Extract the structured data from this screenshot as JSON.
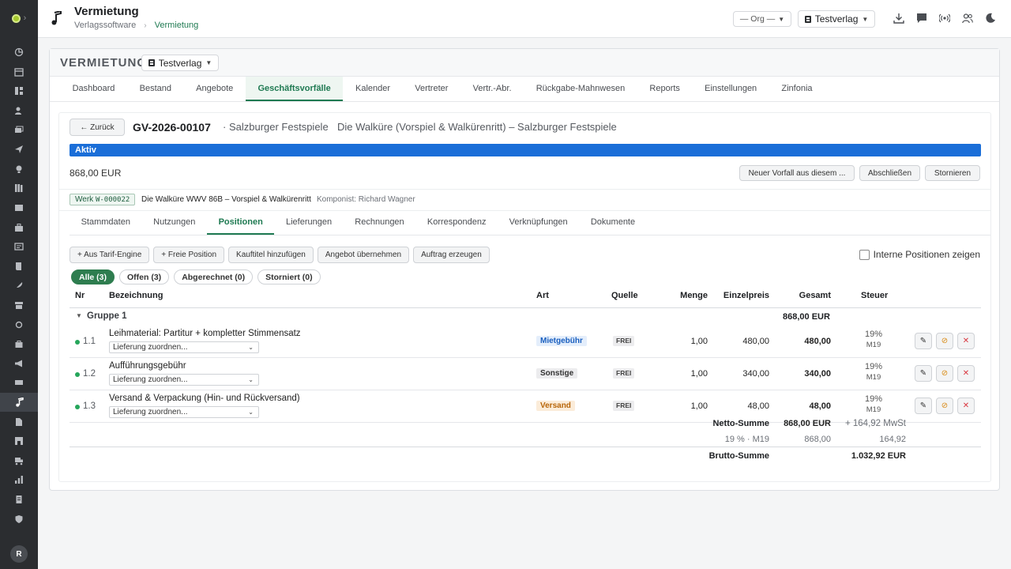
{
  "topbar": {
    "title": "Vermietung",
    "breadcrumb": [
      "Verlagssoftware",
      "Vermietung"
    ],
    "org_select": "— Org —",
    "verlag_select": "Testverlag",
    "actions": [
      "download-icon",
      "chat-icon",
      "broadcast-icon",
      "users-icon",
      "moon-icon"
    ]
  },
  "sidebar": {
    "avatar": "R",
    "icons": [
      "chart-icon",
      "calendar-icon",
      "grid-icon",
      "person-edit-icon",
      "layers-icon",
      "send-icon",
      "bulb-icon",
      "books-icon",
      "image-icon",
      "briefcase-icon",
      "news-icon",
      "scroll-icon",
      "feather-icon",
      "archive-icon",
      "circle-icon",
      "bag-icon",
      "megaphone-icon",
      "film-icon",
      "music-icon",
      "document-icon",
      "store-icon",
      "truck-icon",
      "bar-chart-icon",
      "receipt-icon",
      "shield-icon"
    ],
    "active_index": 18
  },
  "card": {
    "title": "VERMIETUNG",
    "verlag_select": "Testverlag",
    "tabs": [
      "Dashboard",
      "Bestand",
      "Angebote",
      "Geschäftsvorfälle",
      "Kalender",
      "Vertreter",
      "Vertr.-Abr.",
      "Rückgabe-Mahnwesen",
      "Reports",
      "Einstellungen",
      "Zinfonia"
    ],
    "active_tab": 3
  },
  "vorfall": {
    "back_label": "← Zurück",
    "id": "GV-2026-00107",
    "partner": "· Salzburger Festspiele",
    "description": "Die Walküre (Vorspiel & Walkürenritt) – Salzburger Festspiele",
    "status": "Aktiv",
    "amount": "868,00 EUR",
    "actions": [
      "Neuer Vorfall aus diesem ...",
      "Abschließen",
      "Stornieren"
    ],
    "werk_label": "Werk",
    "werk_id": "W-000022",
    "werk_title": "Die Walküre WWV 86B – Vorspiel & Walkürenritt",
    "werk_composer": "Komponist: Richard Wagner"
  },
  "subtabs": {
    "items": [
      "Stammdaten",
      "Nutzungen",
      "Positionen",
      "Lieferungen",
      "Rechnungen",
      "Korrespondenz",
      "Verknüpfungen",
      "Dokumente"
    ],
    "active": 2
  },
  "toolbar": {
    "buttons": [
      "+ Aus Tarif-Engine",
      "+ Freie Position",
      "Kauftitel hinzufügen",
      "Angebot übernehmen",
      "Auftrag erzeugen"
    ],
    "interne_label": "Interne Positionen zeigen"
  },
  "filters": [
    "Alle (3)",
    "Offen (3)",
    "Abgerechnet (0)",
    "Storniert (0)"
  ],
  "table": {
    "headers": {
      "nr": "Nr",
      "bez": "Bezeichnung",
      "art": "Art",
      "quelle": "Quelle",
      "menge": "Menge",
      "ep": "Einzelpreis",
      "gesamt": "Gesamt",
      "steuer": "Steuer"
    },
    "group": {
      "label": "Gruppe 1",
      "total": "868,00 EUR"
    },
    "rows": [
      {
        "nr": "1.1",
        "name": "Leihmaterial: Partitur + kompletter Stimmensatz",
        "select": "Lieferung zuordnen...",
        "art": "Mietgebühr",
        "art_color": "blue",
        "quelle": "FREI",
        "menge": "1,00",
        "ep": "480,00",
        "gesamt": "480,00",
        "tax": "19%",
        "tax_code": "M19"
      },
      {
        "nr": "1.2",
        "name": "Aufführungsgebühr",
        "select": "Lieferung zuordnen...",
        "art": "Sonstige",
        "art_color": "gray",
        "quelle": "FREI",
        "menge": "1,00",
        "ep": "340,00",
        "gesamt": "340,00",
        "tax": "19%",
        "tax_code": "M19"
      },
      {
        "nr": "1.3",
        "name": "Versand & Verpackung (Hin- und Rückversand)",
        "select": "Lieferung zuordnen...",
        "art": "Versand",
        "art_color": "orange",
        "quelle": "FREI",
        "menge": "1,00",
        "ep": "48,00",
        "gesamt": "48,00",
        "tax": "19%",
        "tax_code": "M19"
      }
    ],
    "summary": {
      "netto_label": "Netto-Summe",
      "netto_value": "868,00 EUR",
      "mwst": "+ 164,92 MwSt",
      "tax_line_label": "19 % · M19",
      "tax_line_base": "868,00",
      "tax_line_amount": "164,92",
      "brutto_label": "Brutto-Summe",
      "brutto_value": "1.032,92 EUR"
    }
  },
  "colors": {
    "accent": "#1f7a52",
    "status": "#1a6ed8",
    "sidebar": "#2b2d30"
  }
}
